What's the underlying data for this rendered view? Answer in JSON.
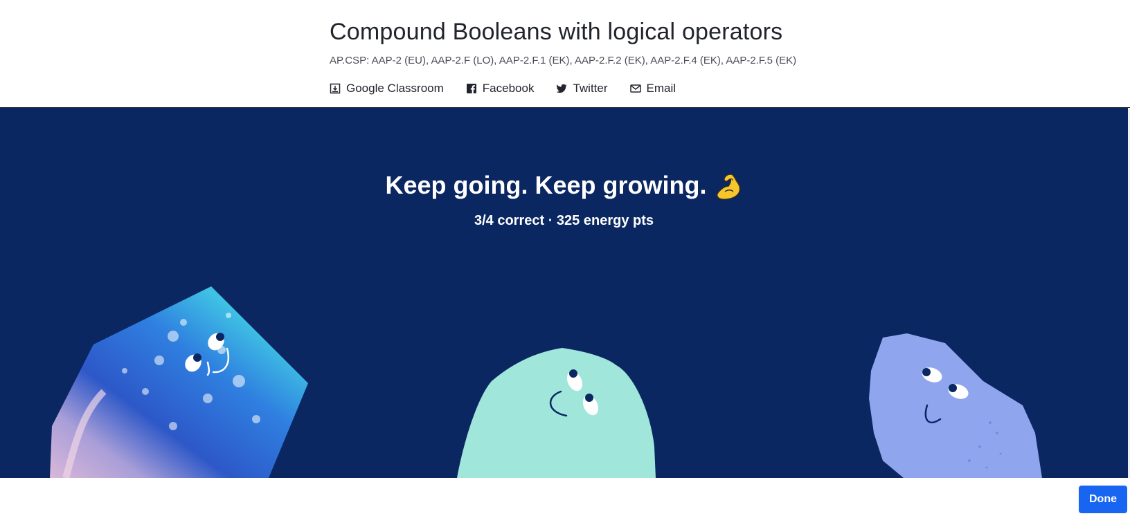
{
  "header": {
    "title": "Compound Booleans with logical operators",
    "standards": "AP.CSP: AAP‑2 (EU), AAP‑2.F (LO), AAP‑2.F.1 (EK), AAP‑2.F.2 (EK), AAP‑2.F.4 (EK), AAP‑2.F.5 (EK)",
    "share": [
      {
        "label": "Google Classroom",
        "icon": "google-classroom-icon"
      },
      {
        "label": "Facebook",
        "icon": "facebook-icon"
      },
      {
        "label": "Twitter",
        "icon": "twitter-icon"
      },
      {
        "label": "Email",
        "icon": "email-icon"
      }
    ]
  },
  "hero": {
    "heading": "Keep going. Keep growing.",
    "heading_emoji": "flexed-biceps-icon",
    "summary": "3/4 correct · 325 energy pts",
    "background_color": "#0b2762"
  },
  "footer": {
    "done_label": "Done",
    "accent_color": "#1865f2"
  }
}
